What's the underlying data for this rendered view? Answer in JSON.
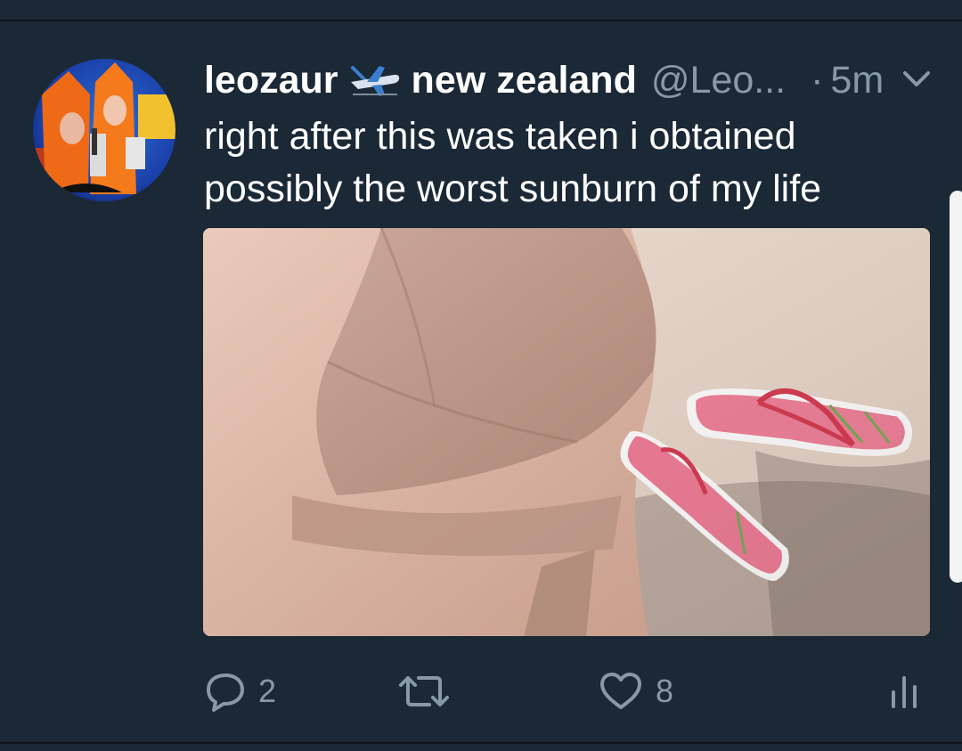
{
  "tweet": {
    "display_name": "leozaur",
    "display_name_suffix": "new zealand",
    "handle": "@Leo...",
    "dot": "·",
    "time": "5m",
    "text": "right after this was taken i obtained possibly the worst sunburn of my life",
    "icons": {
      "name_emoji": "airplane-icon",
      "menu": "chevron-down-icon"
    }
  },
  "actions": {
    "reply_count": "2",
    "retweet_count": "",
    "like_count": "8"
  },
  "colors": {
    "background": "#1b2836",
    "secondary_text": "#8899a6",
    "primary_text": "#ffffff"
  }
}
